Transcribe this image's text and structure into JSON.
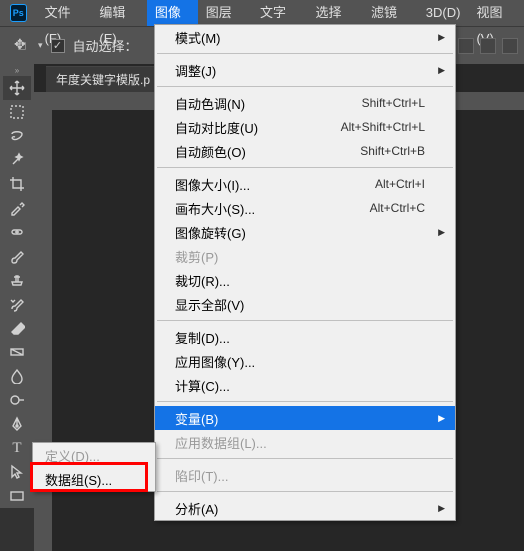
{
  "menubar": {
    "items": [
      "文件(F)",
      "编辑(E)",
      "图像(I)",
      "图层(L)",
      "文字(Y)",
      "选择(S)",
      "滤镜(T)",
      "3D(D)",
      "视图(V)"
    ],
    "open_index": 2
  },
  "options": {
    "auto_select_label": "自动选择："
  },
  "document": {
    "tab_name": "年度关键字模版.p"
  },
  "dropdown": {
    "groups": [
      [
        {
          "label": "模式(M)",
          "submenu": true
        }
      ],
      [
        {
          "label": "调整(J)",
          "submenu": true
        }
      ],
      [
        {
          "label": "自动色调(N)",
          "shortcut": "Shift+Ctrl+L"
        },
        {
          "label": "自动对比度(U)",
          "shortcut": "Alt+Shift+Ctrl+L"
        },
        {
          "label": "自动颜色(O)",
          "shortcut": "Shift+Ctrl+B"
        }
      ],
      [
        {
          "label": "图像大小(I)...",
          "shortcut": "Alt+Ctrl+I"
        },
        {
          "label": "画布大小(S)...",
          "shortcut": "Alt+Ctrl+C"
        },
        {
          "label": "图像旋转(G)",
          "submenu": true
        },
        {
          "label": "裁剪(P)",
          "disabled": true
        },
        {
          "label": "裁切(R)..."
        },
        {
          "label": "显示全部(V)"
        }
      ],
      [
        {
          "label": "复制(D)..."
        },
        {
          "label": "应用图像(Y)..."
        },
        {
          "label": "计算(C)..."
        }
      ],
      [
        {
          "label": "变量(B)",
          "submenu": true,
          "hover": true
        },
        {
          "label": "应用数据组(L)...",
          "disabled": true
        }
      ],
      [
        {
          "label": "陷印(T)...",
          "disabled": true
        }
      ],
      [
        {
          "label": "分析(A)",
          "submenu": true
        }
      ]
    ]
  },
  "submenu": {
    "items": [
      {
        "label": "定义(D)...",
        "disabled": true
      },
      {
        "label": "数据组(S)..."
      }
    ]
  }
}
